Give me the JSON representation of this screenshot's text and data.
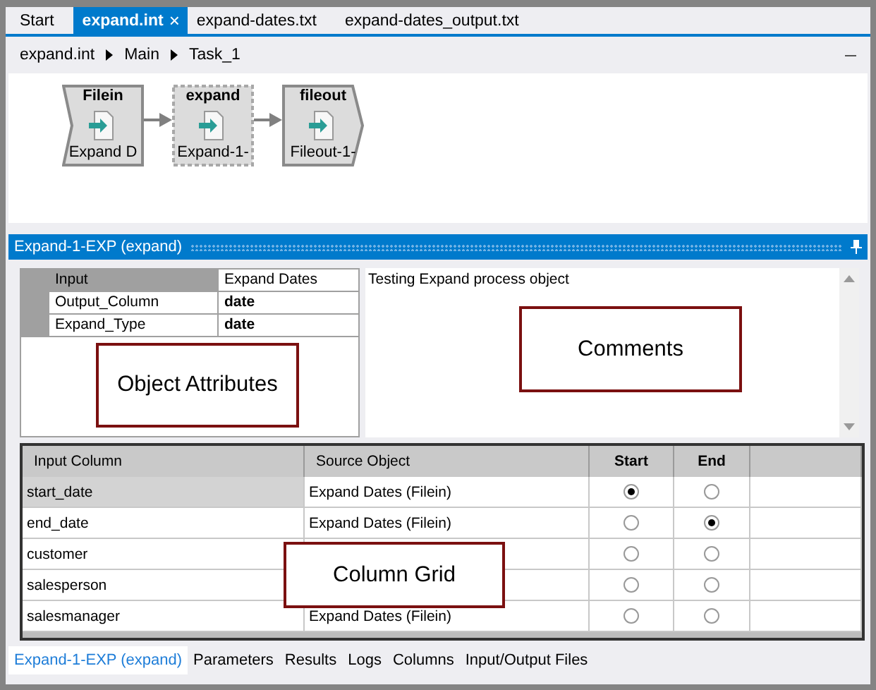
{
  "tabs": [
    {
      "label": "Start",
      "selected": false
    },
    {
      "label": "expand.int",
      "selected": true,
      "close": "×"
    },
    {
      "label": "expand-dates.txt",
      "selected": false
    },
    {
      "label": "expand-dates_output.txt",
      "selected": false
    }
  ],
  "breadcrumb": [
    "expand.int",
    "Main",
    "Task_1"
  ],
  "nodes": [
    {
      "kind": "input",
      "title": "Filein",
      "label": "Expand D",
      "selected": false
    },
    {
      "kind": "process",
      "title": "expand",
      "label": "Expand-1-",
      "selected": true
    },
    {
      "kind": "output",
      "title": "fileout",
      "label": "Fileout-1-",
      "selected": false
    }
  ],
  "panel": {
    "title": "Expand-1-EXP (expand)"
  },
  "attributes": [
    {
      "name": "Input",
      "value": "Expand Dates",
      "bold": false
    },
    {
      "name": "Output_Column",
      "value": "date",
      "bold": true
    },
    {
      "name": "Expand_Type",
      "value": "date",
      "bold": true
    }
  ],
  "comments": "Testing Expand process object",
  "grid": {
    "columns": [
      "Input Column",
      "Source Object",
      "Start",
      "End"
    ],
    "rows": [
      {
        "input": "start_date",
        "source": "Expand Dates (Filein)",
        "start": true,
        "end": false,
        "selected": true
      },
      {
        "input": "end_date",
        "source": "Expand Dates (Filein)",
        "start": false,
        "end": true,
        "selected": false
      },
      {
        "input": "customer",
        "start": false,
        "end": false,
        "selected": false
      },
      {
        "input": "salesperson",
        "start": false,
        "end": false,
        "selected": false
      },
      {
        "input": "salesmanager",
        "source": "Expand Dates (Filein)",
        "start": false,
        "end": false,
        "selected": false
      }
    ]
  },
  "callouts": [
    "Object Attributes",
    "Comments",
    "Column Grid"
  ],
  "bottom_tabs": [
    {
      "label": "Expand-1-EXP (expand)",
      "selected": true
    },
    {
      "label": "Parameters",
      "selected": false
    },
    {
      "label": "Results",
      "selected": false
    },
    {
      "label": "Logs",
      "selected": false
    },
    {
      "label": "Columns",
      "selected": false
    },
    {
      "label": "Input/Output Files",
      "selected": false
    }
  ]
}
